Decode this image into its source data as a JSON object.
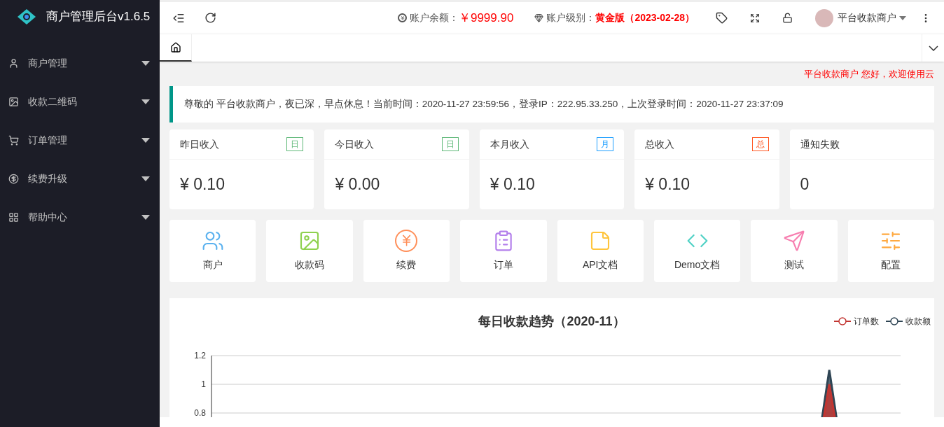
{
  "sidebar": {
    "title": "商户管理后台v1.6.5",
    "items": [
      {
        "kind": "user",
        "label": "商户管理",
        "expanded": false
      },
      {
        "kind": "image",
        "label": "收款二维码",
        "expanded": false
      },
      {
        "kind": "cart",
        "label": "订单管理",
        "expanded": false
      },
      {
        "kind": "yen",
        "label": "续费升级",
        "expanded": false
      },
      {
        "kind": "apps",
        "label": "帮助中心",
        "expanded": false
      }
    ]
  },
  "header": {
    "balance_label": "账户余额：",
    "balance": "￥9999.90",
    "level_label": "账户级别：",
    "level": "黄金版（2023-02-28）",
    "user": "平台收款商户"
  },
  "tabs": [
    {
      "kind": "home",
      "selected": true
    }
  ],
  "marquee": "平台收款商户 您好，欢迎使用云",
  "notice": "尊敬的 平台收款商户，夜已深，早点休息！当前时间：2020-11-27 23:59:56，登录IP：222.95.33.250，上次登录时间：2020-11-27 23:37:09",
  "stats": [
    {
      "title": "昨日收入",
      "badge": "日",
      "color": "#5fb878",
      "value": "¥ 0.10"
    },
    {
      "title": "今日收入",
      "badge": "日",
      "color": "#5fb878",
      "value": "¥ 0.00"
    },
    {
      "title": "本月收入",
      "badge": "月",
      "color": "#1e9fff",
      "value": "¥ 0.10"
    },
    {
      "title": "总收入",
      "badge": "总",
      "color": "#ff5722",
      "value": "¥ 0.10"
    },
    {
      "title": "通知失败",
      "value": "0"
    }
  ],
  "shortcuts": [
    {
      "kind": "users",
      "label": "商户",
      "color": "#5ab1ef"
    },
    {
      "kind": "image",
      "label": "收款码",
      "color": "#8fd14f"
    },
    {
      "kind": "yen",
      "label": "续费",
      "color": "#ff8f59"
    },
    {
      "kind": "clipboard",
      "label": "订单",
      "color": "#b37feb"
    },
    {
      "kind": "note",
      "label": "API文档",
      "color": "#ffc53d"
    },
    {
      "kind": "code",
      "label": "Demo文档",
      "color": "#4fd1c5"
    },
    {
      "kind": "send",
      "label": "测试",
      "color": "#f77fb0"
    },
    {
      "kind": "sliders",
      "label": "配置",
      "color": "#ffa940"
    }
  ],
  "chart": {
    "chart_data": {
      "type": "area",
      "title": "每日收款趋势（2020-11）",
      "ylim": [
        0,
        1.2
      ],
      "yticks": [
        0.8,
        1,
        1.2
      ],
      "series": [
        {
          "name": "订单数",
          "color": "#c23531",
          "values": [
            0,
            0,
            0,
            0,
            0,
            0,
            0,
            0,
            0,
            0,
            0,
            0,
            0,
            0,
            0,
            0,
            0,
            0,
            0,
            0,
            0,
            0,
            0,
            0,
            0,
            0,
            1,
            0,
            0,
            0
          ]
        },
        {
          "name": "收款额",
          "color": "#2f4554",
          "values": [
            0,
            0,
            0,
            0,
            0,
            0,
            0,
            0,
            0,
            0,
            0,
            0,
            0,
            0,
            0,
            0,
            0,
            0,
            0,
            0,
            0,
            0,
            0,
            0,
            0,
            0,
            1.1,
            0,
            0,
            0
          ]
        }
      ]
    }
  }
}
